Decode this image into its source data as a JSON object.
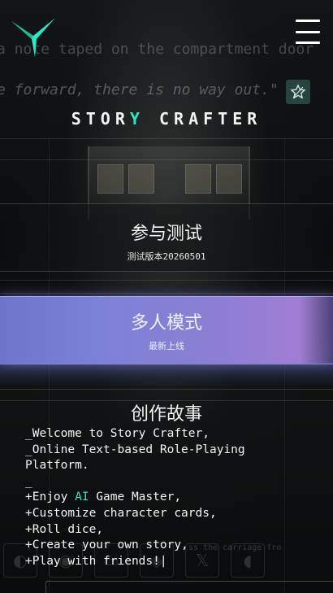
{
  "background": {
    "note_line_1": "a note taped on the compartment door",
    "note_line_2": "e forward, there is no way out.\"",
    "side_note": "ss the carriage fro"
  },
  "header": {
    "logo_icon": "y-logo-icon",
    "menu_icon": "hamburger-menu-icon",
    "bookmark_icon": "star-bookmark-icon",
    "brand_left": "STOR",
    "brand_mid": "Y",
    "brand_right": "CRAFTER"
  },
  "menu": {
    "test": {
      "title": "参与测试",
      "subtitle": "测试版本20260501"
    },
    "multiplayer": {
      "title": "多人模式",
      "subtitle": "最新上线"
    },
    "create": {
      "title": "创作故事"
    }
  },
  "terminal": {
    "line1": "_Welcome to Story Crafter,",
    "line2": "_Online Text-based Role-Playing",
    "line3": "Platform.",
    "line4": "_",
    "line5_pre": "+Enjoy ",
    "line5_ai": "AI",
    "line5_post": " Game Master,",
    "line6": "+Customize character cards,",
    "line7": "+Roll dice,",
    "line8": "+Create your own story,",
    "line9": "+Play with friends!|"
  },
  "colors": {
    "accent": "#2ee6c4",
    "multiplayer_gradient_start": "#6f73c9",
    "multiplayer_gradient_end": "#a07ed3"
  }
}
